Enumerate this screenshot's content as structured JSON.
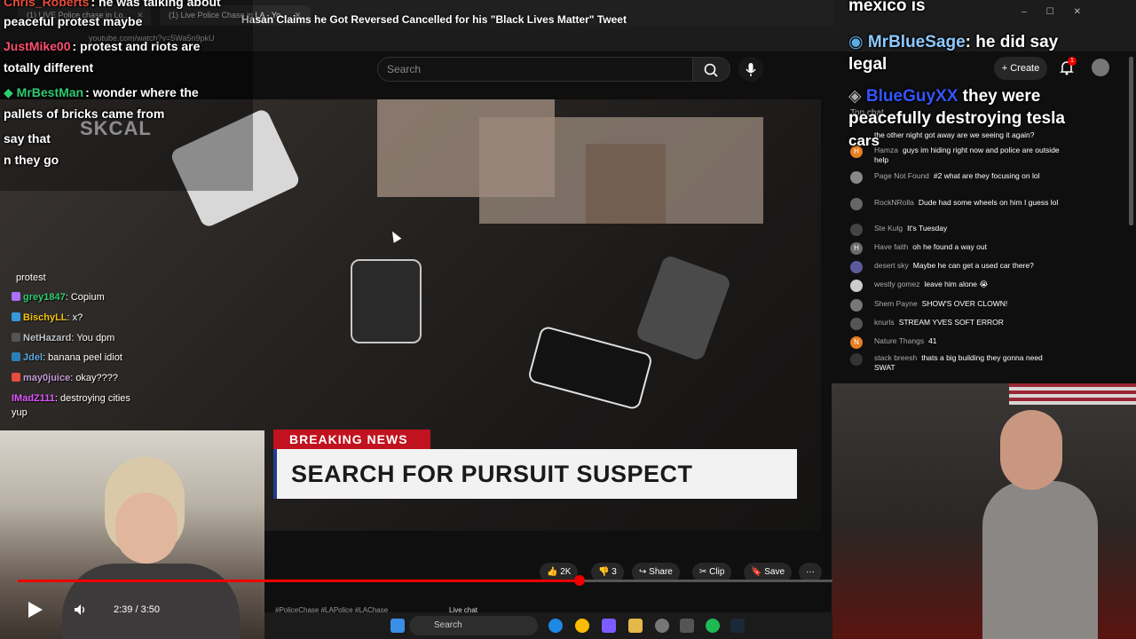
{
  "browser": {
    "tabs": [
      {
        "label": "(1) LIVE Police chase in Lo..."
      },
      {
        "label": "(1) Live Police Chase in LA - Yo..."
      }
    ],
    "url": "youtube.com/watch?v=5Wa5n9pkU"
  },
  "video_title": "Hasan Claims he Got Reversed Cancelled for his \"Black Lives Matter\" Tweet",
  "header": {
    "search_placeholder": "Search",
    "create_label": "Create",
    "notif_count": "1"
  },
  "overlay_chat_left": [
    {
      "user": "Chris_Roberts",
      "text": ": he was talking about"
    },
    {
      "user": "",
      "text": "peaceful protest maybe"
    },
    {
      "user": "JustMike00",
      "text": ": protest and riots are"
    },
    {
      "user": "",
      "text": "totally different"
    },
    {
      "user": "MrBestMan",
      "text": ": wonder where the"
    },
    {
      "user": "",
      "text": "pallets of bricks came from"
    },
    {
      "user": "",
      "text": "say that"
    },
    {
      "user": "",
      "text": "n they go"
    }
  ],
  "video": {
    "watermark": "SKCAL",
    "lower_third_tag": "BREAKING NEWS",
    "lower_third_headline": "SEARCH FOR PURSUIT SUSPECT"
  },
  "twitch_chat": [
    {
      "user": "",
      "text": "protest",
      "color": "#ffffff",
      "badge": ""
    },
    {
      "user": "grey1847",
      "text": ": Copium",
      "color": "#2ecc71",
      "badge": "#a970ff"
    },
    {
      "user": "BischyLL",
      "text": ": x?",
      "color": "#f1c40f",
      "badge": "#3498db"
    },
    {
      "user": "NetHazard",
      "text": ": You dpm",
      "color": "#bdc3c7",
      "badge": ""
    },
    {
      "user": "Jdel",
      "text": ": banana peel idiot",
      "color": "#5dade2",
      "badge": "#2980b9"
    },
    {
      "user": "may0juice",
      "text": ": okay????",
      "color": "#c39bd3",
      "badge": "#e74c3c"
    },
    {
      "user": "IMadZ111",
      "text": ": destroying cities",
      "color": "#e056fd",
      "badge": ""
    },
    {
      "user": "",
      "text": "yup",
      "color": "#ffffff",
      "badge": ""
    }
  ],
  "overlay_chat_right": [
    {
      "user": "",
      "text": "mexico is"
    },
    {
      "user": "MrBlueSage",
      "text": ": he did say"
    },
    {
      "user": "",
      "text": "legal"
    },
    {
      "user": "BlueGuyXX",
      "text": " they were"
    },
    {
      "user": "",
      "text": "peacefully destroying tesla"
    },
    {
      "user": "",
      "text": "cars"
    }
  ],
  "yt_chat": {
    "header": "Top chat",
    "messages": [
      {
        "user": "",
        "text": "the other night got away are we seeing it again?",
        "avatar": ""
      },
      {
        "user": "Hamza",
        "text": "guys im hiding right now and police are outside help",
        "avatar": "H"
      },
      {
        "user": "Page Not Found",
        "text": "#2 what are they focusing on lol",
        "avatar": ""
      },
      {
        "user": "RockNRolla",
        "text": "Dude had some wheels on him I guess lol",
        "avatar": ""
      },
      {
        "user": "Ste Kulg",
        "text": "It's Tuesday",
        "avatar": ""
      },
      {
        "user": "Have faith",
        "text": "oh he found a way out",
        "avatar": "H"
      },
      {
        "user": "desert sky",
        "text": "Maybe he can get a used car there?",
        "avatar": ""
      },
      {
        "user": "westly gomez",
        "text": "leave him alone 😭",
        "avatar": ""
      },
      {
        "user": "Shem Payne",
        "text": "SHOW'S OVER CLOWN!",
        "avatar": ""
      },
      {
        "user": "knurls",
        "text": "STREAM YVES SOFT ERROR",
        "avatar": ""
      },
      {
        "user": "Nature Thangs",
        "text": "41",
        "avatar": "N"
      },
      {
        "user": "stack breesh",
        "text": "thats a big building they gonna need SWAT",
        "avatar": ""
      }
    ]
  },
  "actions": {
    "like_count": "2K",
    "dislike_count": "3",
    "share": "Share",
    "clip": "Clip",
    "save": "Save"
  },
  "player": {
    "time": "2:39 / 3:50",
    "progress": 0.69
  },
  "below_row": {
    "tags": "#PoliceChase #LAPolice #LAChase",
    "live_chat": "Live chat"
  },
  "taskbar": {
    "search_placeholder": "Search"
  }
}
